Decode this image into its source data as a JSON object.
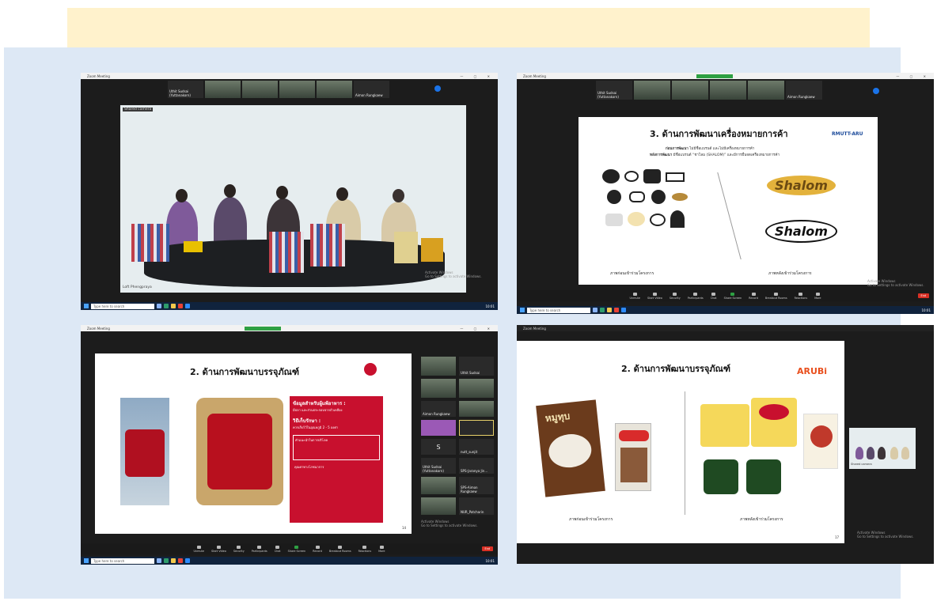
{
  "shot1": {
    "window_title": "Zoom Meeting",
    "strip_names": [
      "Uthit Sudsai (Yuttanakorn)",
      "",
      "",
      "",
      "Aimon Rungkaew"
    ],
    "speaker_label": "Shared camera",
    "caption_name": "Loft Phengpraya",
    "taskbar_search": "Type here to search",
    "clock": "10:01"
  },
  "shot2": {
    "window_title": "Zoom Meeting",
    "strip_names": [
      "Uthit Sudsai (Yuttanakorn)",
      "",
      "",
      "",
      "Aimon Rungkaew"
    ],
    "slide_title": "3. ด้านการพัฒนาเครื่องหมายการค้า",
    "logo": "RMUTT-ARU",
    "line1_bold": "ก่อนการพัฒนา",
    "line1_rest": "ไม่มีชื่อแบรนด์ และไม่มีเครื่องหมายการค้า",
    "line2_bold": "หลังการพัฒนา",
    "line2_rest": "มีชื่อแบรนด์ “ชาโลม (SHALOM)” และมีการยื่นจดเครื่องหมายการค้า",
    "before_caption": "ภาพก่อนเข้าร่วมโครงการ",
    "after_caption": "ภาพหลังเข้าร่วมโครงการ",
    "brand_sample": "Shalom",
    "watermark_1": "Activate Windows",
    "watermark_2": "Go to Settings to activate Windows.",
    "taskbar_search": "Type here to search",
    "clock": "10:01",
    "toolbar": [
      "Unmute",
      "Start Video",
      "Security",
      "Participants",
      "Chat",
      "Share Screen",
      "Record",
      "Breakout Rooms",
      "Reactions",
      "More"
    ],
    "end_label": "End"
  },
  "shot3": {
    "window_title": "Zoom Meeting",
    "slide_title": "2. ด้านการพัฒนาบรรจุภัณฑ์",
    "info_title_1": "ข้อมูลสำหรับผู้แพ้อาหาร :",
    "info_body_1": "มีปลา และส่วนประกอบจากถั่วเหลือง",
    "info_title_2": "วิธีเก็บรักษา :",
    "info_body_2": "ควรเก็บไว้ในอุณหภูมิ 2 - 5 องศา",
    "info_block_3": "คำแนะนำในการบริโภค",
    "info_block_4": "คุณค่าทางโภชนาการ",
    "page_no": "14",
    "participants": [
      "Uthit Sudsai",
      "",
      "Aimon Rungkaew",
      "",
      "S",
      "nutt_sunjit",
      "Uthit Sudsai (Yuttanakorn)",
      "SPS-Jaranya Jin…",
      "",
      "SPS-Aimon Rungkaew",
      "",
      "NUR_Patcharin"
    ],
    "watermark_1": "Activate Windows",
    "watermark_2": "Go to Settings to activate Windows.",
    "taskbar_search": "Type here to search",
    "clock": "10:01",
    "toolbar": [
      "Unmute",
      "Start Video",
      "Security",
      "Participants",
      "Chat",
      "Share Screen",
      "Record",
      "Breakout Rooms",
      "Reactions",
      "More"
    ],
    "end_label": "End"
  },
  "shot4": {
    "window_title": "Zoom Meeting",
    "slide_title": "2. ด้านการพัฒนาบรรจุภัณฑ์",
    "logo": "ARUBi",
    "before_caption": "ภาพก่อนเข้าร่วมโครงการ",
    "after_caption": "ภาพหลังเข้าร่วมโครงการ",
    "before_label": "หมูทุบ",
    "page_no": "17",
    "thumb_name": "Shared camera",
    "watermark_1": "Activate Windows",
    "watermark_2": "Go to Settings to activate Windows."
  },
  "colors": {
    "banner": "#fff2cc",
    "panel": "#dde8f5",
    "accent_red": "#c8102e",
    "zoom_blue": "#1a73e8"
  },
  "icons": [
    "windows-start-icon",
    "search-icon",
    "microphone-icon",
    "video-icon",
    "shield-icon",
    "participants-icon",
    "chat-icon",
    "share-screen-icon",
    "record-icon",
    "breakout-icon",
    "reactions-icon",
    "more-icon"
  ]
}
